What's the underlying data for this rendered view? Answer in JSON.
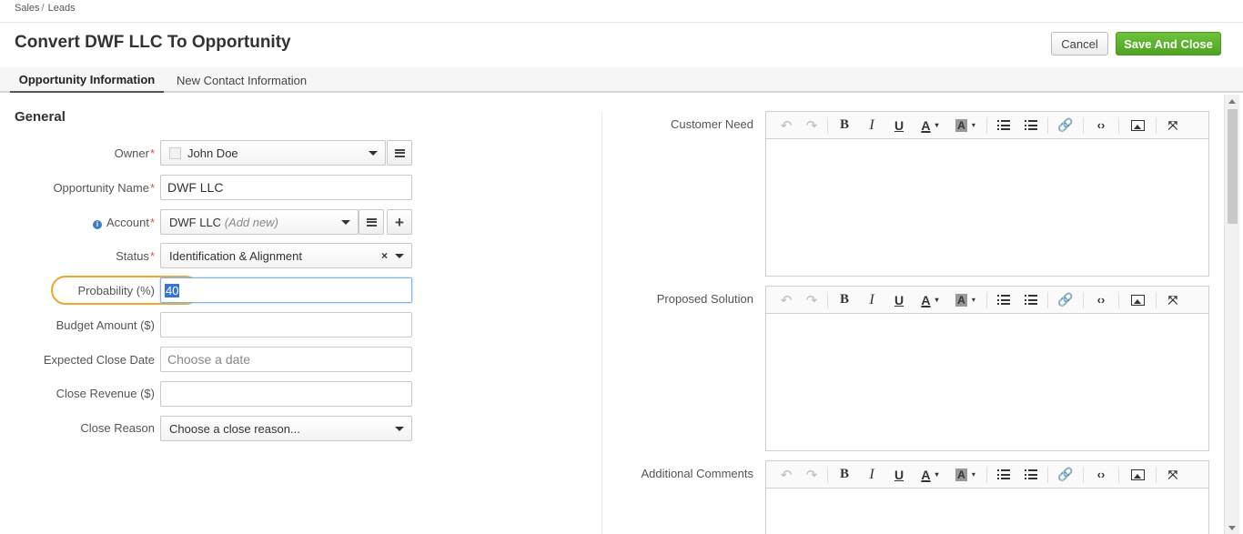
{
  "breadcrumb": {
    "items": [
      "Sales",
      "Leads"
    ],
    "separator": "/"
  },
  "page": {
    "title": "Convert DWF LLC To Opportunity"
  },
  "actions": {
    "cancel_label": "Cancel",
    "save_label": "Save And Close"
  },
  "tabs": [
    {
      "label": "Opportunity Information",
      "active": true
    },
    {
      "label": "New Contact Information",
      "active": false
    }
  ],
  "general": {
    "section_title": "General",
    "owner": {
      "label": "Owner",
      "required": "*",
      "value": "John Doe"
    },
    "opportunity_name": {
      "label": "Opportunity Name",
      "required": "*",
      "value": "DWF LLC"
    },
    "account": {
      "label": "Account",
      "required": "*",
      "value": "DWF LLC",
      "add_new": "(Add new)"
    },
    "status": {
      "label": "Status",
      "required": "*",
      "value": "Identification & Alignment",
      "clear": "×"
    },
    "probability": {
      "label": "Probability (%)",
      "value": "40"
    },
    "budget_amount": {
      "label": "Budget Amount ($)",
      "value": ""
    },
    "expected_close_date": {
      "label": "Expected Close Date",
      "placeholder": "Choose a date"
    },
    "close_revenue": {
      "label": "Close Revenue ($)",
      "value": ""
    },
    "close_reason": {
      "label": "Close Reason",
      "value": "Choose a close reason..."
    }
  },
  "editors": [
    {
      "label": "Customer Need"
    },
    {
      "label": "Proposed Solution"
    },
    {
      "label": "Additional Comments"
    }
  ],
  "toolbar_glyphs": {
    "undo": "↶",
    "redo": "↷",
    "bold": "B",
    "italic": "I",
    "underline": "U",
    "font_color": "A",
    "bg_color": "A",
    "dropdown": "▾",
    "link": "🔗",
    "code": "‹›",
    "fullscreen": "⤧"
  },
  "colors": {
    "primary_button": "#5bb12f",
    "required": "#d9534f",
    "highlight_ring": "#f0a629",
    "info": "#3d7fbf"
  }
}
